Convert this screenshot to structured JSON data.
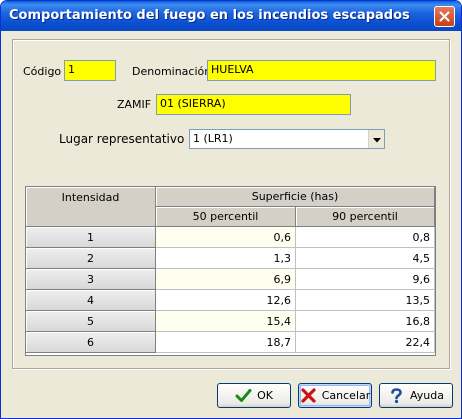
{
  "window": {
    "title": "Comportamiento del fuego en los incendios escapados"
  },
  "form": {
    "codigo_label": "Código",
    "codigo_value": "1",
    "denominacion_label": "Denominación",
    "denominacion_value": "HUELVA",
    "zamif_label": "ZAMIF",
    "zamif_value": "01 (SIERRA)",
    "lugar_label": "Lugar representativo",
    "lugar_value": "1 (LR1)"
  },
  "table": {
    "intensidad_header": "Intensidad",
    "superficie_header": "Superficie (has)",
    "p50_header": "50 percentil",
    "p90_header": "90 percentil",
    "rows": [
      {
        "intensidad": "1",
        "p50": "0,6",
        "p90": "0,8"
      },
      {
        "intensidad": "2",
        "p50": "1,3",
        "p90": "4,5"
      },
      {
        "intensidad": "3",
        "p50": "6,9",
        "p90": "9,6"
      },
      {
        "intensidad": "4",
        "p50": "12,6",
        "p90": "13,5"
      },
      {
        "intensidad": "5",
        "p50": "15,4",
        "p90": "16,8"
      },
      {
        "intensidad": "6",
        "p50": "18,7",
        "p90": "22,4"
      }
    ]
  },
  "buttons": {
    "ok_label": "OK",
    "cancel_label": "Cancelar",
    "help_label": "Ayuda"
  },
  "colors": {
    "field_highlight": "#ffff00",
    "titlebar": "#0b4fd0",
    "dialog_bg": "#ece9d8"
  },
  "icons": {
    "ok": "check-icon",
    "cancel": "x-icon",
    "help": "question-icon",
    "close": "close-icon",
    "dropdown": "chevron-down-icon"
  }
}
